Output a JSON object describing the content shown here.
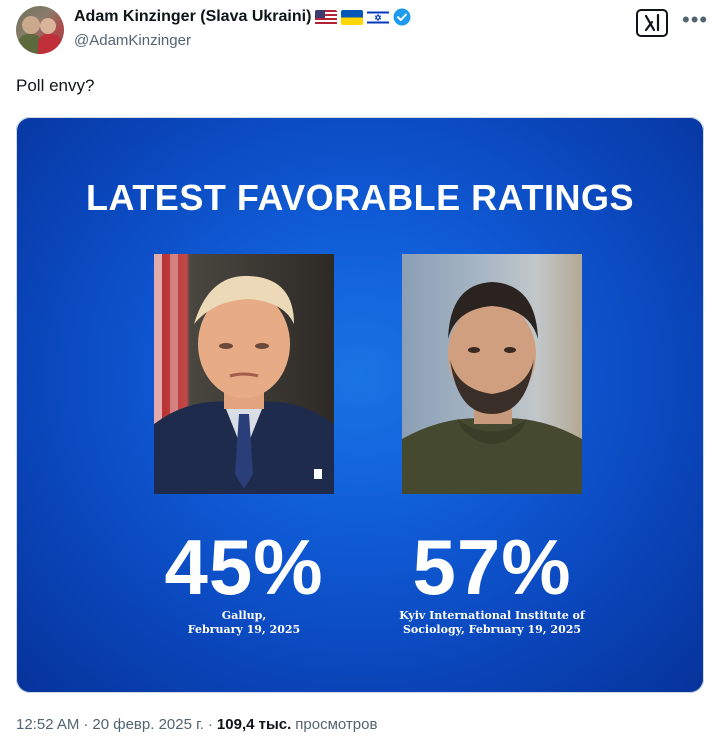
{
  "author": {
    "display_name": "Adam Kinzinger (Slava Ukraini)",
    "handle": "@AdamKinzinger",
    "flags": [
      "us-flag-icon",
      "ukraine-flag-icon",
      "israel-flag-icon"
    ],
    "verified_color": "#1d9bf0"
  },
  "tweet": {
    "text": "Poll envy?"
  },
  "media": {
    "title": "LATEST FAVORABLE RATINGS",
    "left": {
      "value": "45%",
      "source_lines": [
        "Gallup,",
        "February 19, 2025"
      ]
    },
    "right": {
      "value": "57%",
      "source_lines": [
        "Kyiv International Institute of",
        "Sociology, February 19, 2025"
      ]
    },
    "background_color": "#0f5bd6"
  },
  "meta": {
    "time": "12:52 AM",
    "sep1": "·",
    "date": "20 февр. 2025 г.",
    "sep2": "·",
    "views_count": "109,4 тыс.",
    "views_label": "просмотров"
  }
}
